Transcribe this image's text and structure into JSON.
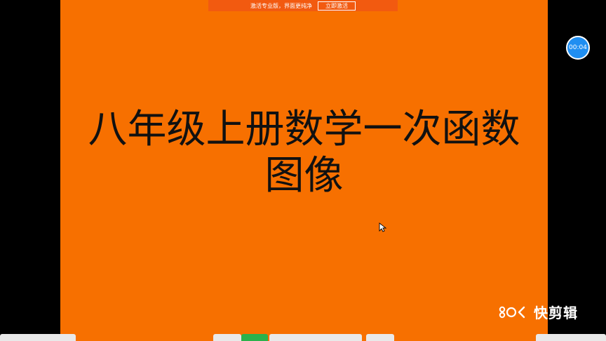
{
  "promo_banner": {
    "text": "激活专业版，界面更纯净",
    "button_label": "立即激活"
  },
  "slide": {
    "background_color": "#f77000",
    "title_line_1": "八年级上册数学一次函数",
    "title_line_2": "图像"
  },
  "timer": {
    "label": "00:04",
    "color": "#1f8ef1"
  },
  "watermark": {
    "brand": "快剪辑",
    "logo_icon": "kuaijianji-logo-icon"
  },
  "taskbar": {
    "accent_color": "#2bb24c"
  }
}
